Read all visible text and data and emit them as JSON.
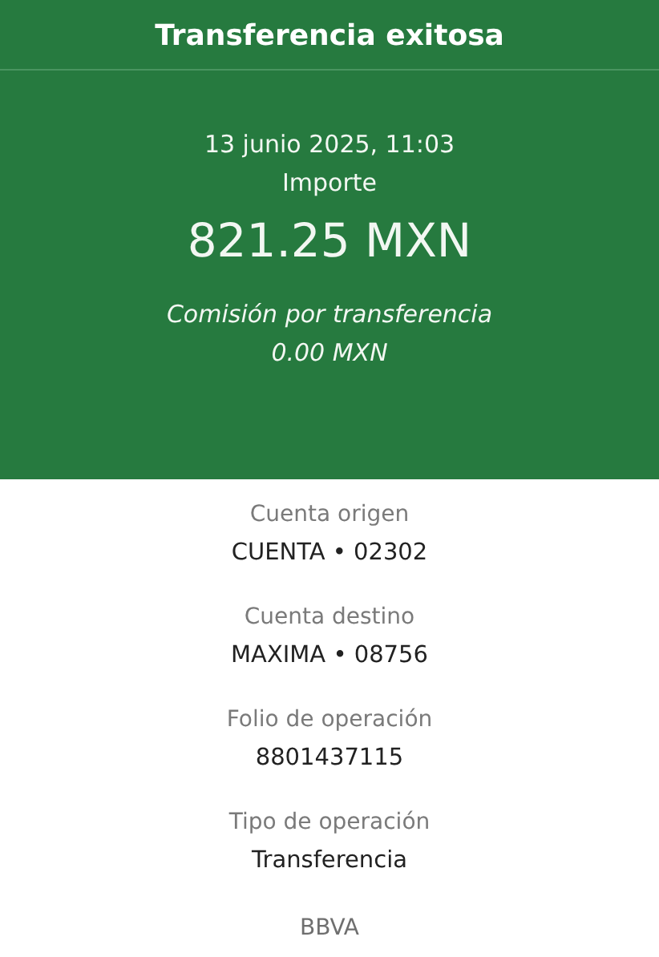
{
  "header": {
    "title": "Transferencia exitosa"
  },
  "summary": {
    "datetime": "13 junio 2025, 11:03",
    "amount_label": "Importe",
    "amount": "821.25 MXN",
    "fee_label": "Comisión por transferencia",
    "fee": "0.00 MXN"
  },
  "details": [
    {
      "label": "Cuenta origen",
      "value": "CUENTA • 02302"
    },
    {
      "label": "Cuenta destino",
      "value": "MAXIMA • 08756"
    },
    {
      "label": "Folio de operación",
      "value": "8801437115"
    },
    {
      "label": "Tipo de operación",
      "value": "Transferencia"
    }
  ],
  "footer": {
    "text": "BBVA"
  }
}
